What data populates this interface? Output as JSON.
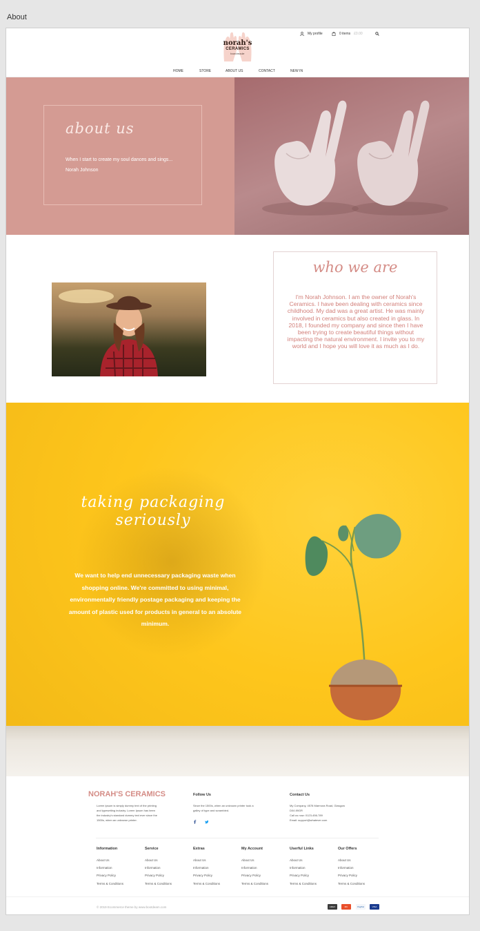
{
  "window": {
    "title": "About"
  },
  "header": {
    "logo": {
      "line1": "norah's",
      "line2": "CERAMICS",
      "line3": "handmade"
    },
    "my_profile": "My profile",
    "cart_items": "0 items",
    "cart_total": "£0.00",
    "nav": [
      "HOME",
      "STORE",
      "ABOUT US",
      "CONTACT",
      "NEW IN"
    ]
  },
  "hero": {
    "title": "about us",
    "quote": "When I start to create my soul dances and sings...",
    "author": "Norah Johnson"
  },
  "who": {
    "title": "who we are",
    "text": "I'm Norah Johnson. I am the owner of Norah's Ceramics. I have been dealing with ceramics since childhood. My dad was a great artist. He was mainly involved in ceramics but also created in glass. In 2018, I founded my company and since then I have been trying to create beautiful things without impacting the natural environment. I invite you to my world and I hope you will love it as much as I do."
  },
  "packaging": {
    "title_line1": "taking packaging",
    "title_line2": "seriously",
    "text": "We want to help end unnecessary packaging waste when shopping online. We're committed to using minimal, environmentally friendly postage packaging and keeping the amount of plastic used for products in general to an absolute minimum."
  },
  "footer": {
    "brand": "NORAH'S CERAMICS",
    "brand_text": [
      "Lorem Ipsum is simply dummy text of the printing",
      "and typesetting industry. Lorem Ipsum has been",
      "the industry's standard dummy text ever since the",
      "1500s, when an unknown printer."
    ],
    "follow_title": "Follow Us",
    "follow_text": [
      "Since the 1500s, when an unknown printer took a",
      "galley of type and scrambled."
    ],
    "contact_title": "Contact Us",
    "contact_lines": [
      "My Company, 4578 Marmora Road, Glasgow",
      "D04 89GR",
      "Call us now: 0123-456-789",
      "Email: support@whatever.com"
    ],
    "columns": [
      {
        "title": "Information",
        "links": [
          "About Us",
          "Information",
          "Privacy Policy",
          "Terms & Conditions"
        ]
      },
      {
        "title": "Service",
        "links": [
          "About Us",
          "Information",
          "Privacy Policy",
          "Terms & Conditions"
        ]
      },
      {
        "title": "Extras",
        "links": [
          "About Us",
          "Information",
          "Privacy Policy",
          "Terms & Conditions"
        ]
      },
      {
        "title": "My Account",
        "links": [
          "About Us",
          "Information",
          "Privacy Policy",
          "Terms & Conditions"
        ]
      },
      {
        "title": "Userful Links",
        "links": [
          "About Us",
          "Information",
          "Privacy Policy",
          "Terms & Conditions"
        ]
      },
      {
        "title": "Our Offers",
        "links": [
          "About Us",
          "Information",
          "Privacy Policy",
          "Terms & Conditions"
        ]
      }
    ],
    "copyright": "© 2019 Ecommerce theme by www.bootdeam.com",
    "payments": [
      "AMEX",
      "MC",
      "PayPal",
      "VISA"
    ]
  },
  "colors": {
    "accent": "#d48c86",
    "hero_bg": "#d49b93",
    "yellow": "#fec61c"
  }
}
